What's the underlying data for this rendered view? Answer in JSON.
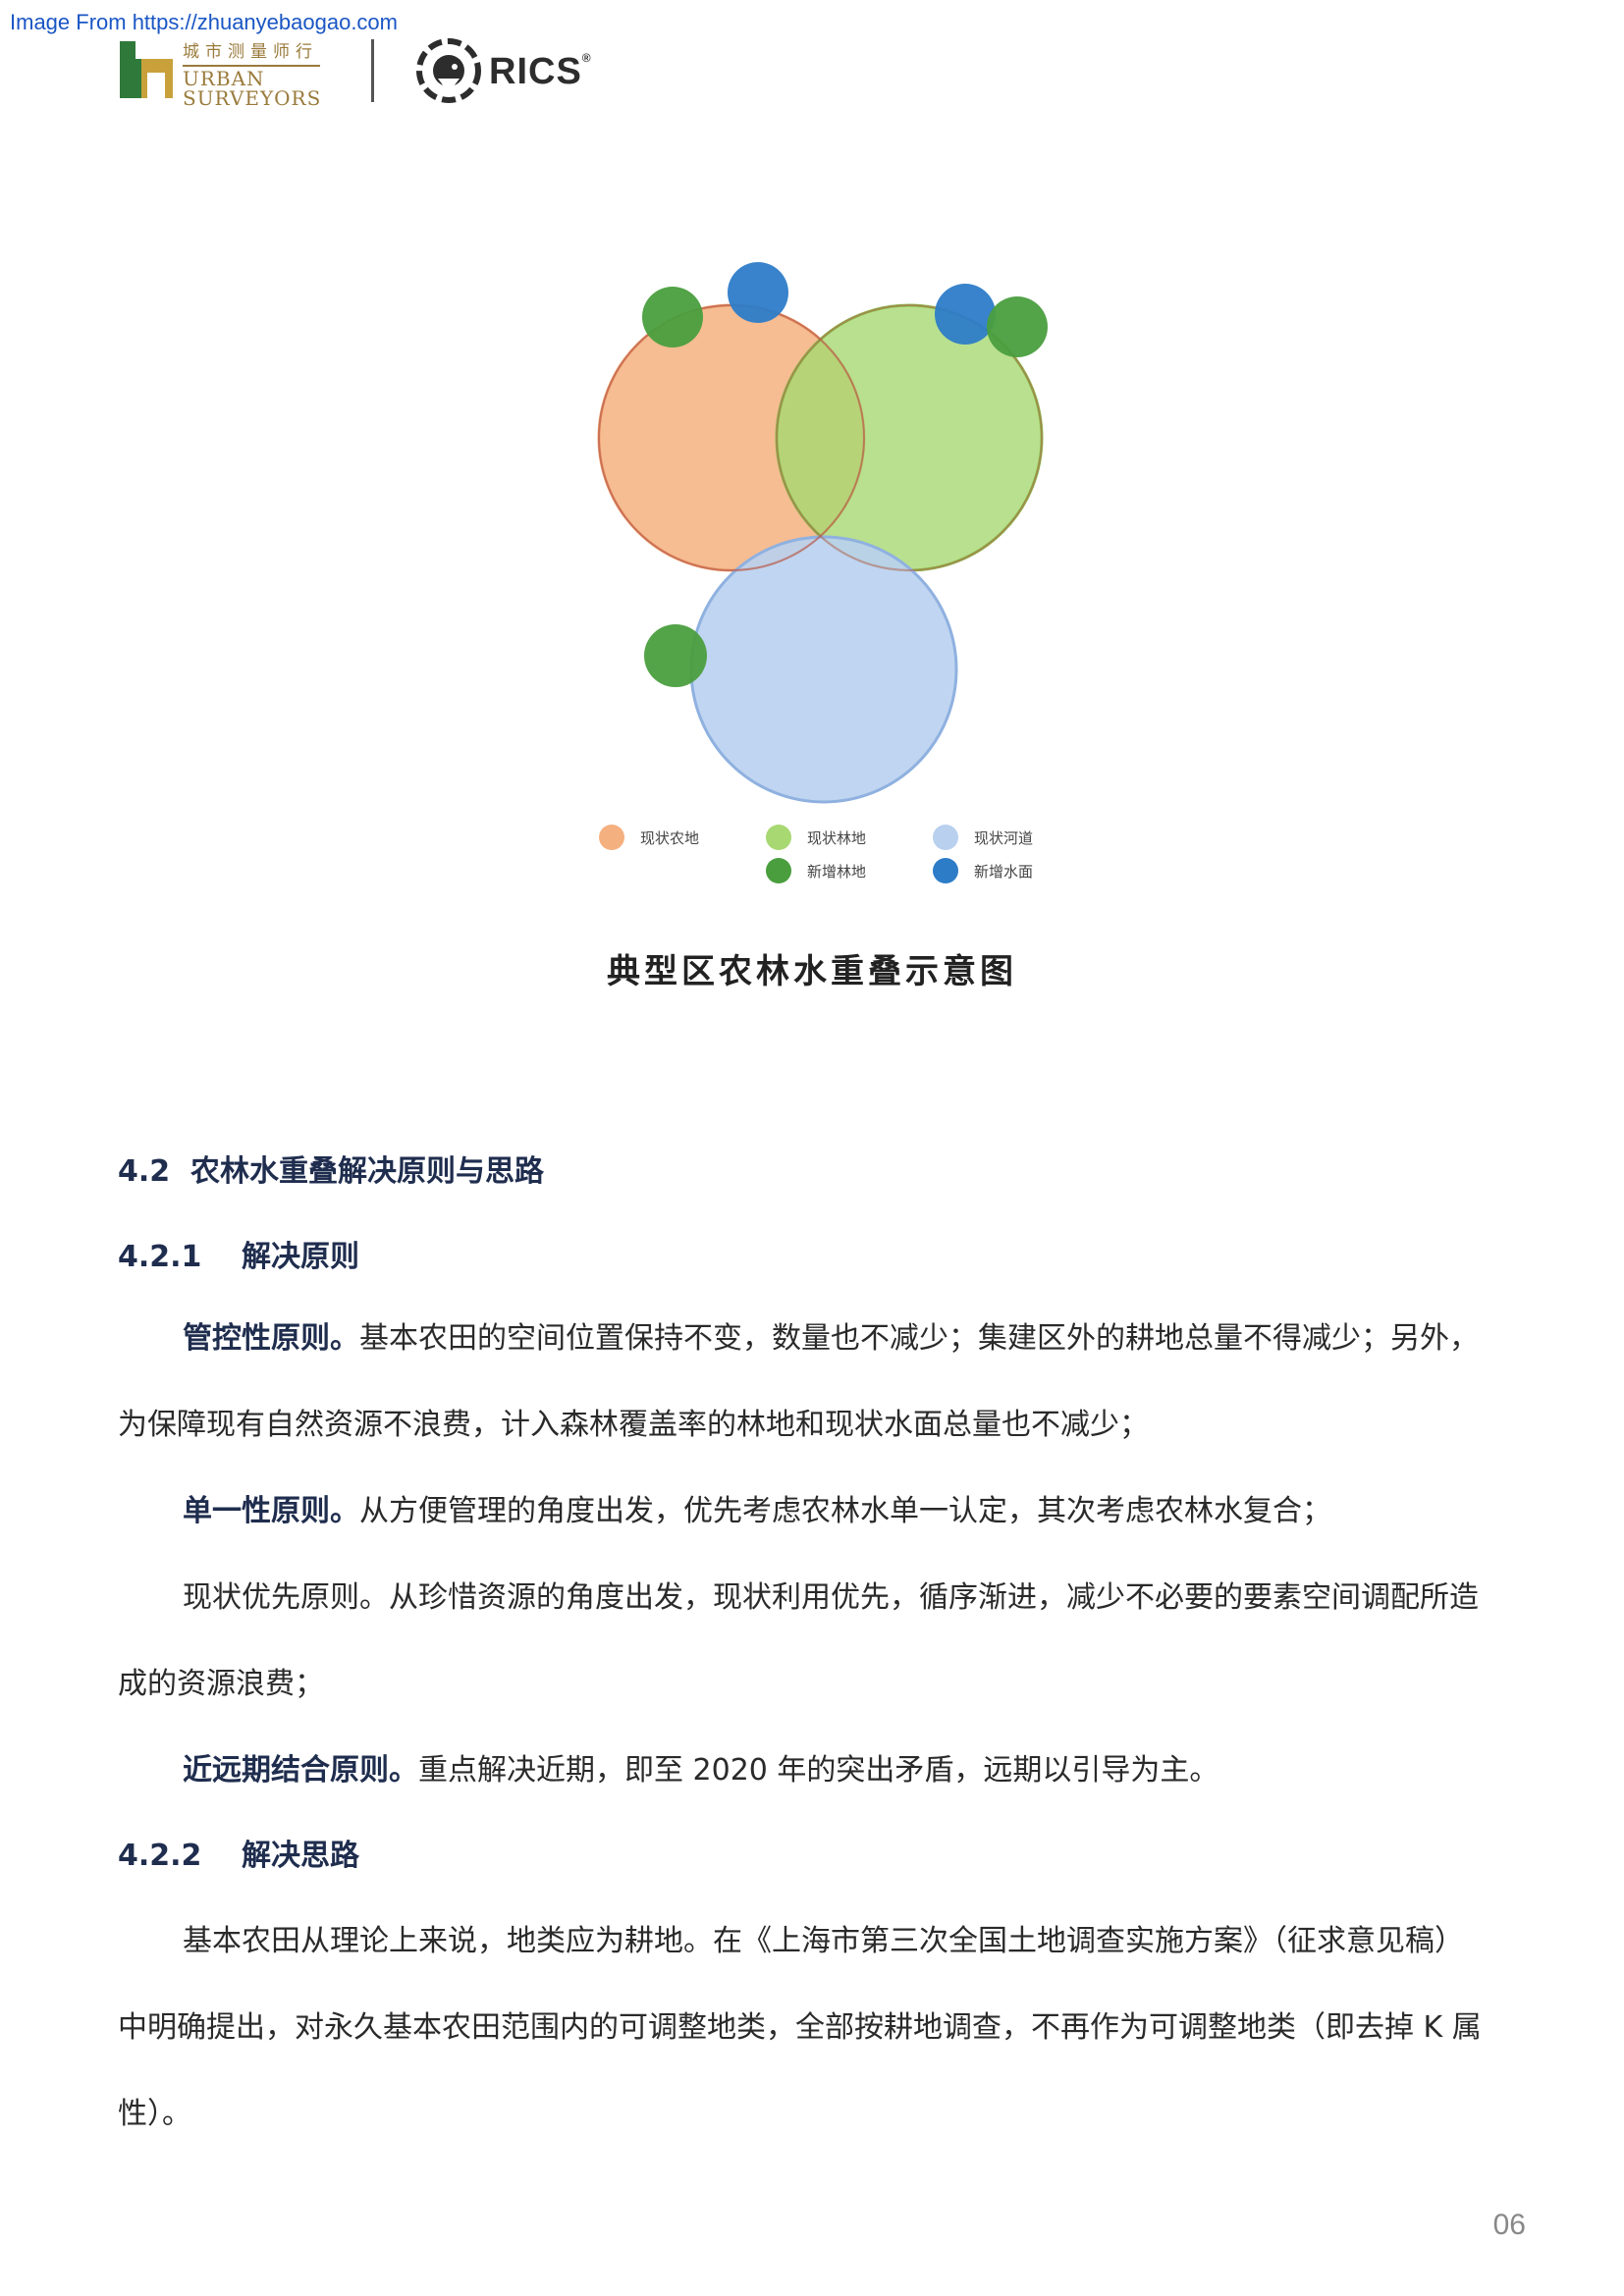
{
  "watermark": "Image From https://zhuanyebaogao.com",
  "header": {
    "urban_cn": "城市测量师行",
    "urban_en_1": "URBAN",
    "urban_en_2": "SURVEYORS",
    "rics": "RICS"
  },
  "figure": {
    "caption": "典型区农林水重叠示意图",
    "legend": [
      {
        "label": "现状农地",
        "color": "#f5b07f"
      },
      {
        "label": "现状林地",
        "color": "#a8d872"
      },
      {
        "label": "现状河道",
        "color": "#b9d0ef"
      },
      {
        "label": "新增林地",
        "color": "#4a9e3e"
      },
      {
        "label": "新增水面",
        "color": "#2d7cc8"
      }
    ]
  },
  "section_42": {
    "num": "4.2",
    "title": "农林水重叠解决原则与思路"
  },
  "section_421": {
    "num": "4.2.1",
    "title": "解决原则"
  },
  "p1_bold": "管控性原则。",
  "p1_text": "基本农田的空间位置保持不变，数量也不减少；集建区外的耕地总量不得减少；另外，",
  "p1_text2": "为保障现有自然资源不浪费，计入森林覆盖率的林地和现状水面总量也不减少；",
  "p2_bold": "单一性原则。",
  "p2_text": "从方便管理的角度出发，优先考虑农林水单一认定，其次考虑农林水复合；",
  "p3_text": "现状优先原则。从珍惜资源的角度出发，现状利用优先，循序渐进，减少不必要的要素空间调配所造",
  "p3_text2": "成的资源浪费；",
  "p4_bold": "近远期结合原则。",
  "p4_text": "重点解决近期，即至 2020 年的突出矛盾，远期以引导为主。",
  "section_422": {
    "num": "4.2.2",
    "title": "解决思路"
  },
  "p5_text": "基本农田从理论上来说，地类应为耕地。在《上海市第三次全国土地调查实施方案》（征求意见稿）",
  "p5_text2": "中明确提出，对永久基本农田范围内的可调整地类，全部按耕地调查，不再作为可调整地类（即去掉 K 属",
  "p5_text3": "性）。",
  "page_number": "06"
}
